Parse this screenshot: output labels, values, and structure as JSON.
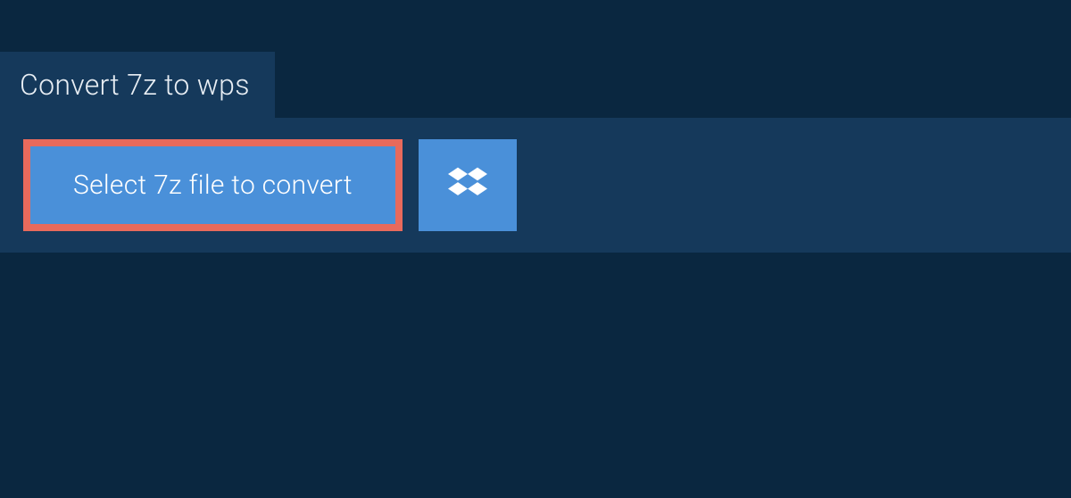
{
  "tab": {
    "title": "Convert 7z to wps"
  },
  "actions": {
    "select_file_label": "Select 7z file to convert",
    "dropbox_icon": "dropbox-icon"
  },
  "colors": {
    "background": "#0a2740",
    "panel": "#15395b",
    "button": "#4a90d9",
    "highlight_border": "#e86a5c",
    "text_light": "#ffffff"
  }
}
